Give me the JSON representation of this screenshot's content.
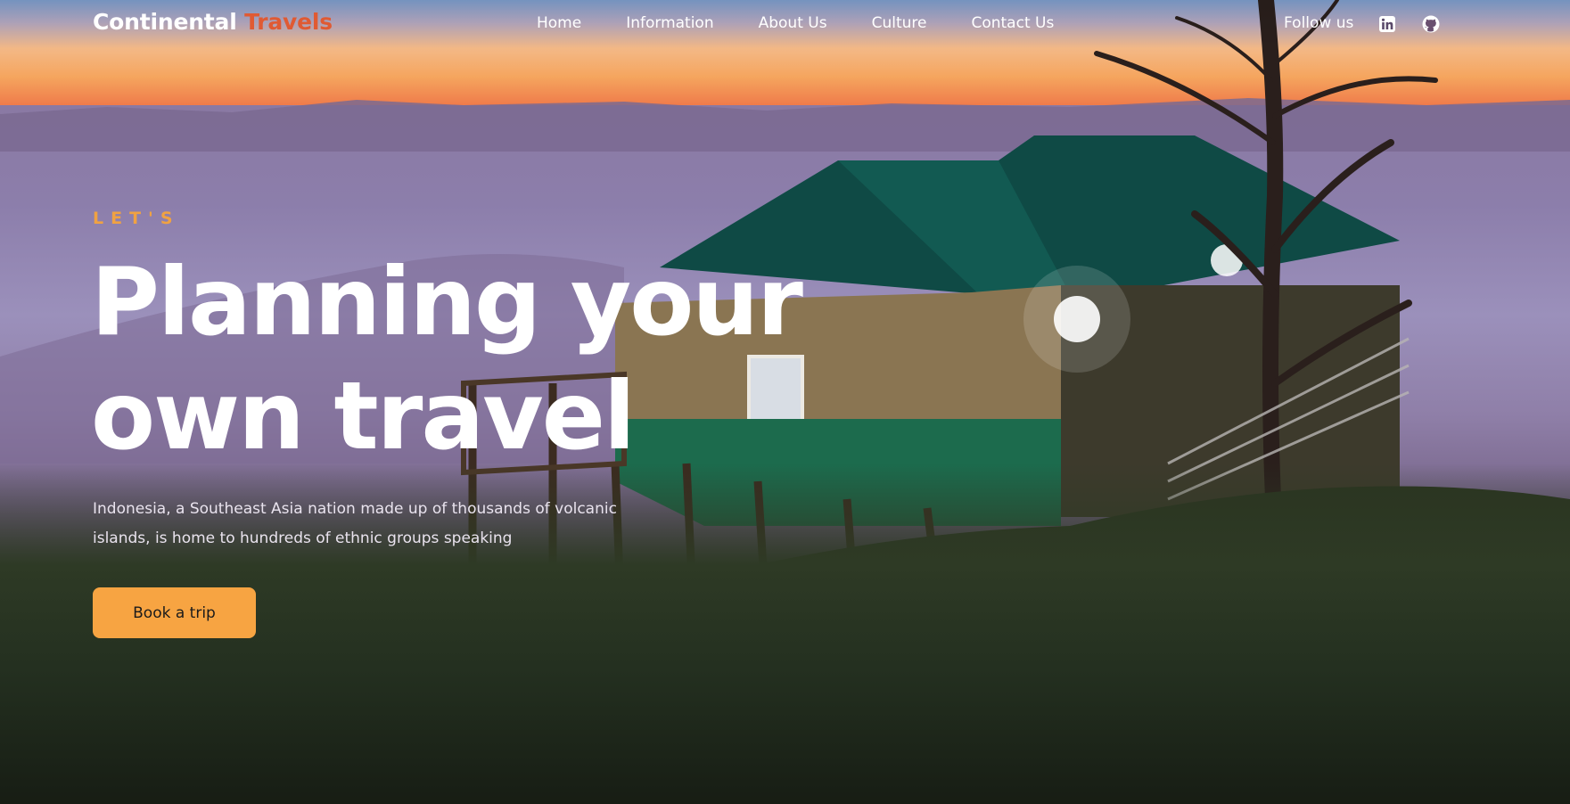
{
  "header": {
    "brand_primary": "Continental",
    "brand_accent": "Travels",
    "nav": [
      {
        "label": "Home"
      },
      {
        "label": "Information"
      },
      {
        "label": "About Us"
      },
      {
        "label": "Culture"
      },
      {
        "label": "Contact Us"
      }
    ],
    "follow_label": "Follow us",
    "social_icons": [
      "linkedin-icon",
      "github-icon"
    ]
  },
  "hero": {
    "eyebrow": "LET'S",
    "headline_line1": "Planning your",
    "headline_line2": "own travel",
    "description": "Indonesia, a Southeast Asia nation made up of thousands of volcanic islands, is home to hundreds of ethnic groups speaking",
    "cta_label": "Book a trip"
  },
  "colors": {
    "brand_accent": "#e05a33",
    "eyebrow": "#f0a242",
    "cta_background": "#f7a442",
    "text": "#ffffff"
  }
}
